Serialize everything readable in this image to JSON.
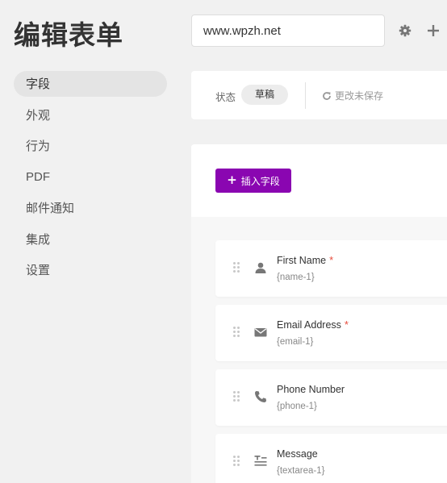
{
  "header": {
    "title": "编辑表单",
    "form_name": "www.wpzh.net",
    "settings_icon": "gear-icon",
    "add_icon": "plus-icon"
  },
  "sidebar": {
    "items": [
      {
        "label": "字段",
        "active": true
      },
      {
        "label": "外观"
      },
      {
        "label": "行为"
      },
      {
        "label": "PDF"
      },
      {
        "label": "邮件通知"
      },
      {
        "label": "集成"
      },
      {
        "label": "设置"
      }
    ]
  },
  "status_bar": {
    "status_label": "状态",
    "status_value": "草稿",
    "save_icon": "refresh-icon",
    "save_text": "更改未保存"
  },
  "builder": {
    "insert_button": "插入字段",
    "fields": [
      {
        "label": "First Name",
        "required_mark": "*",
        "tag": "{name-1}",
        "icon": "user-icon"
      },
      {
        "label": "Email Address",
        "required_mark": "*",
        "tag": "{email-1}",
        "icon": "envelope-icon"
      },
      {
        "label": "Phone Number",
        "required_mark": "",
        "tag": "{phone-1}",
        "icon": "phone-icon"
      },
      {
        "label": "Message",
        "required_mark": "",
        "tag": "{textarea-1}",
        "icon": "textarea-icon"
      }
    ]
  },
  "colors": {
    "accent": "#8a06b1",
    "required": "#e74c3c"
  }
}
